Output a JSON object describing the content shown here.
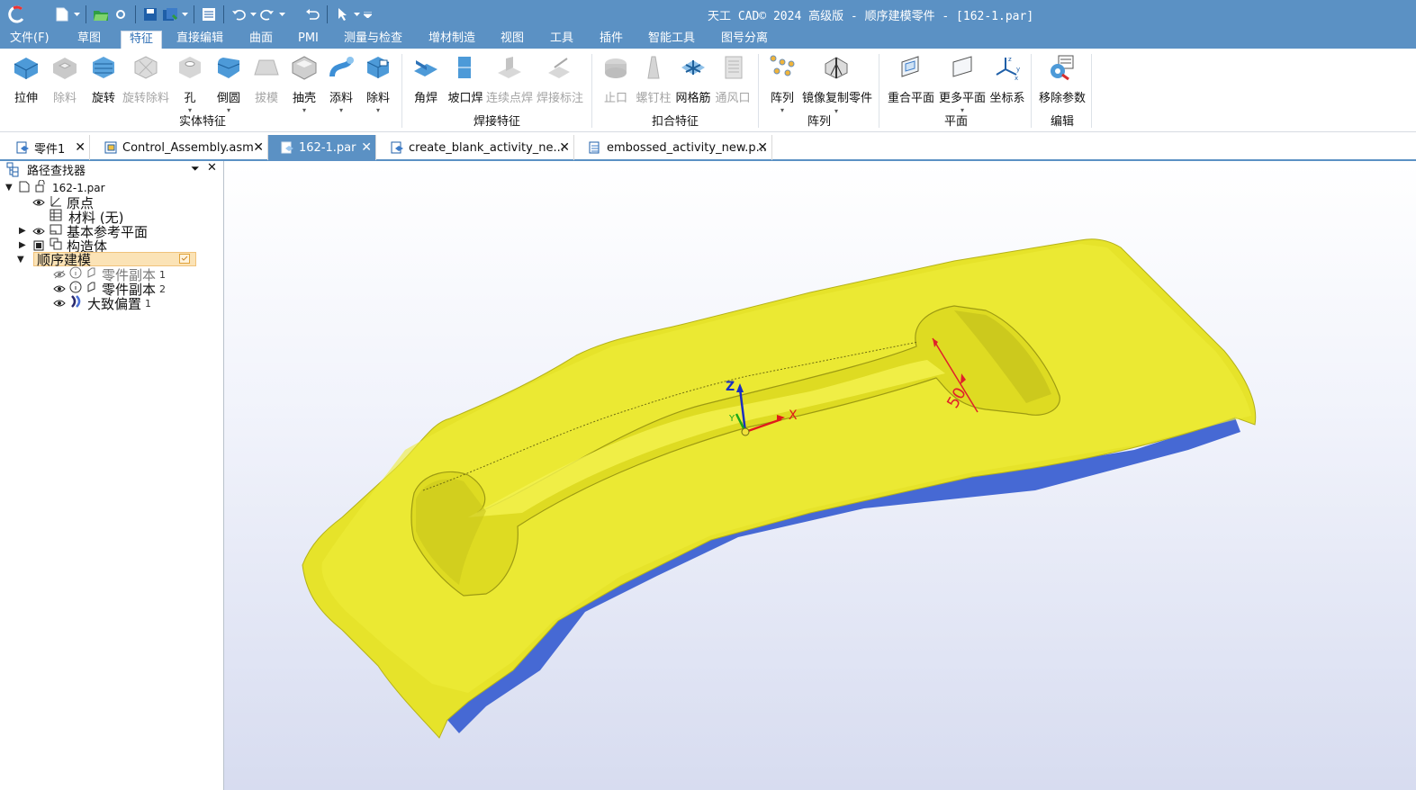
{
  "titlebar": {
    "title": "天工 CAD© 2024 高级版 - 顺序建模零件 - [162-1.par]"
  },
  "menubar": {
    "items": [
      "文件(F)",
      "草图",
      "特征",
      "直接编辑",
      "曲面",
      "PMI",
      "测量与检查",
      "增材制造",
      "视图",
      "工具",
      "插件",
      "智能工具",
      "图号分离"
    ],
    "active": "特征"
  },
  "ribbon": {
    "solid_features": {
      "label": "实体特征",
      "buttons": [
        "拉伸",
        "除料",
        "旋转",
        "旋转除料",
        "孔",
        "倒圆",
        "拔模",
        "抽壳",
        "添料",
        "除料"
      ]
    },
    "weld_features": {
      "label": "焊接特征",
      "buttons": [
        "角焊",
        "坡口焊",
        "连续点焊",
        "焊接标注"
      ]
    },
    "fit_features": {
      "label": "扣合特征",
      "buttons": [
        "止口",
        "螺钉柱",
        "网格筋",
        "通风口"
      ]
    },
    "pattern": {
      "label": "阵列",
      "buttons": [
        "阵列",
        "镜像复制零件"
      ]
    },
    "plane": {
      "label": "平面",
      "buttons": [
        "重合平面",
        "更多平面",
        "坐标系"
      ]
    },
    "edit": {
      "label": "编辑",
      "buttons": [
        "移除参数"
      ]
    }
  },
  "tabs": [
    {
      "label": "零件1",
      "active": false
    },
    {
      "label": "Control_Assembly.asm",
      "active": false
    },
    {
      "label": "162-1.par",
      "active": true
    },
    {
      "label": "create_blank_activity_ne...",
      "active": false
    },
    {
      "label": "embossed_activity_new.p...",
      "active": false
    }
  ],
  "pathfinder": {
    "title": "路径查找器",
    "root": "162-1.par",
    "items": [
      {
        "label": "原点",
        "num": ""
      },
      {
        "label": "材料 (无)",
        "num": ""
      },
      {
        "label": "基本参考平面",
        "num": ""
      },
      {
        "label": "构造体",
        "num": ""
      },
      {
        "label": "顺序建模",
        "num": ""
      },
      {
        "label": "零件副本",
        "num": "1"
      },
      {
        "label": "零件副本",
        "num": "2"
      },
      {
        "label": "大致偏置",
        "num": "1"
      }
    ]
  },
  "viewport": {
    "dimension_label": "50",
    "axis_x": "X",
    "axis_y": "Y",
    "axis_z": "Z",
    "colors": {
      "part_top": "#e6e32a",
      "part_edge": "#4367d6",
      "dimension": "#e0202a"
    }
  }
}
